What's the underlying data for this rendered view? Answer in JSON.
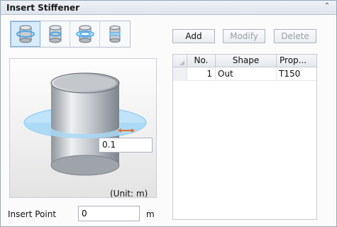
{
  "panel": {
    "title": "Insert Stiffener",
    "collapse_icon": "chevron-up-icon"
  },
  "shape_buttons": [
    {
      "name": "stiffener-type-1-button",
      "active": true
    },
    {
      "name": "stiffener-type-2-button",
      "active": false
    },
    {
      "name": "stiffener-type-3-button",
      "active": false
    },
    {
      "name": "stiffener-type-4-button",
      "active": false
    }
  ],
  "preview": {
    "value": "0.1",
    "unit_label": "(Unit:     m)"
  },
  "insert_point": {
    "label": "Insert Point",
    "value": "0",
    "unit": "m"
  },
  "buttons": {
    "add": "Add",
    "modify": "Modify",
    "delete": "Delete"
  },
  "table": {
    "columns": [
      "No.",
      "Shape",
      "Prop..."
    ],
    "rows": [
      {
        "no": "1",
        "shape": "Out",
        "prop": "T150"
      }
    ]
  },
  "colors": {
    "accent": "#7ab4e2",
    "ring": "#8fd0f5",
    "arrow": "#e2712a"
  }
}
